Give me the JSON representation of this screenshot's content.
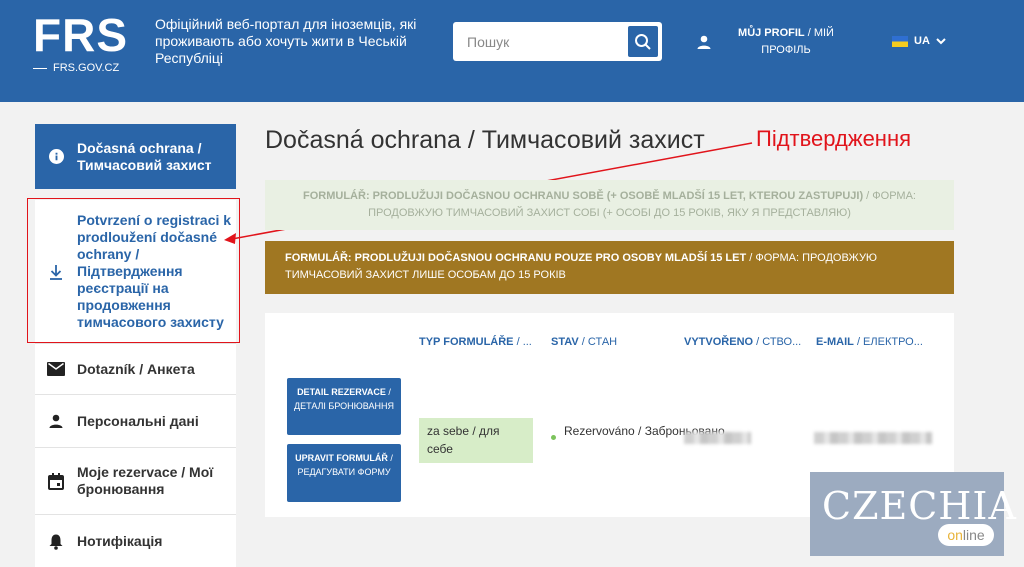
{
  "header": {
    "logo": "FRS",
    "logo_sub": "FRS.GOV.CZ",
    "tagline": "Офіційний веб-портал для іноземців, які проживають або хочуть жити в Чеській Республіці",
    "search_placeholder": "Пошук",
    "profile_bold": "MŮJ PROFIL",
    "profile_thin": " / МІЙ ПРОФІЛЬ",
    "lang": "UA"
  },
  "sidebar": {
    "items": [
      {
        "label": "Dočasná ochrana / Тимчасовий захист",
        "icon": "info-icon"
      },
      {
        "label": "Potvrzení o registraci k prodloužení dočasné ochrany / Підтвердження реєстрації на продовження тимчасового захисту",
        "icon": "download-icon"
      },
      {
        "label": "Dotazník / Анкета",
        "icon": "mail-icon"
      },
      {
        "label": "Персональні дані",
        "icon": "person-icon"
      },
      {
        "label": "Moje rezervace / Мої бронювання",
        "icon": "calendar-icon"
      },
      {
        "label": "Нотифікація",
        "icon": "bell-icon"
      }
    ]
  },
  "main": {
    "title": "Dočasná ochrana / Тимчасовий захист",
    "annotation": "Підтвердження",
    "banner1": {
      "bold": "FORMULÁŘ: PRODLUŽUJI DOČASNOU OCHRANU SOBĚ (+ OSOBĚ MLADŠÍ 15 LET, KTEROU ZASTUPUJI)",
      "thin": " / ФОРМА: ПРОДОВЖУЮ ТИМЧАСОВИЙ ЗАХИСТ СОБІ (+ ОСОБІ ДО 15 РОКІВ, ЯКУ Я ПРЕДСТАВЛЯЮ)"
    },
    "banner2": {
      "bold": "FORMULÁŘ: PRODLUŽUJI DOČASNOU OCHRANU POUZE PRO OSOBY MLADŠÍ 15 LET",
      "thin": " / ФОРМА: ПРОДОВЖУЮ ТИМЧАСОВИЙ ЗАХИСТ ЛИШЕ ОСОБАМ ДО 15 РОКІВ"
    },
    "table": {
      "headers": [
        {
          "bold": "TYP FORMULÁŘE",
          "thin": " / ..."
        },
        {
          "bold": "STAV",
          "thin": " / СТАН"
        },
        {
          "bold": "VYTVOŘENO",
          "thin": " / СТВО..."
        },
        {
          "bold": "E-MAIL",
          "thin": " / ЕЛЕКТРО..."
        }
      ],
      "detail_bold": "DETAIL REZERVACE",
      "detail_thin": " / ДЕТАЛІ БРОНЮВАННЯ",
      "edit_bold": "UPRAVIT FORMULÁŘ",
      "edit_thin": " / РЕДАГУВАТИ ФОРМУ",
      "type_value": "za sebe / для себе",
      "status_value": "Rezervováno / Заброньовано"
    }
  },
  "watermark": {
    "text": "CZECHIA",
    "online_on": "on",
    "online_line": "line"
  },
  "colors": {
    "header": "#2a65a8",
    "annotation": "#e1141b",
    "banner_orange": "#a07722",
    "banner_green": "#e9f0e3"
  }
}
